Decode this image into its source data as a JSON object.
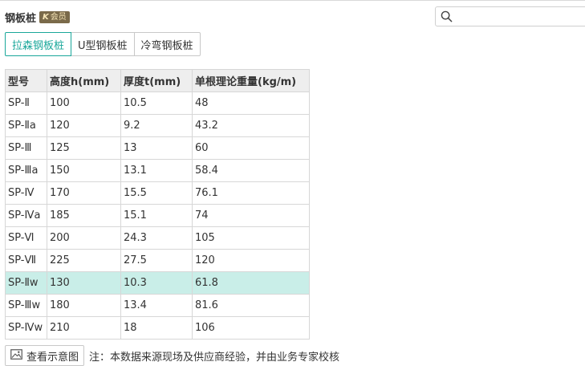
{
  "header": {
    "title": "钢板桩",
    "badge": "会员",
    "badge_mark": "K"
  },
  "search": {
    "value": "",
    "placeholder": ""
  },
  "tabs": [
    {
      "label": "拉森钢板桩",
      "active": true
    },
    {
      "label": "U型钢板桩",
      "active": false
    },
    {
      "label": "冷弯钢板桩",
      "active": false
    }
  ],
  "table": {
    "columns": [
      "型号",
      "高度h(mm)",
      "厚度t(mm)",
      "单根理论重量(kg/m)"
    ],
    "rows": [
      {
        "cells": [
          "SP-Ⅱ",
          "100",
          "10.5",
          "48"
        ],
        "highlight": false
      },
      {
        "cells": [
          "SP-Ⅱa",
          "120",
          "9.2",
          "43.2"
        ],
        "highlight": false
      },
      {
        "cells": [
          "SP-Ⅲ",
          "125",
          "13",
          "60"
        ],
        "highlight": false
      },
      {
        "cells": [
          "SP-Ⅲa",
          "150",
          "13.1",
          "58.4"
        ],
        "highlight": false
      },
      {
        "cells": [
          "SP-Ⅳ",
          "170",
          "15.5",
          "76.1"
        ],
        "highlight": false
      },
      {
        "cells": [
          "SP-Ⅳa",
          "185",
          "15.1",
          "74"
        ],
        "highlight": false
      },
      {
        "cells": [
          "SP-Ⅵ",
          "200",
          "24.3",
          "105"
        ],
        "highlight": false
      },
      {
        "cells": [
          "SP-Ⅶ",
          "225",
          "27.5",
          "120"
        ],
        "highlight": false
      },
      {
        "cells": [
          "SP-Ⅱw",
          "130",
          "10.3",
          "61.8"
        ],
        "highlight": true
      },
      {
        "cells": [
          "SP-Ⅲw",
          "180",
          "13.4",
          "81.6"
        ],
        "highlight": false
      },
      {
        "cells": [
          "SP-Ⅳw",
          "210",
          "18",
          "106"
        ],
        "highlight": false
      }
    ]
  },
  "footer": {
    "view_button_label": "查看示意图",
    "note": "注：本数据来源现场及供应商经验，并由业务专家校核"
  },
  "colors": {
    "accent": "#1aa79a",
    "highlight_row": "#c9eee8",
    "badge_bg": "#7a6a4a"
  },
  "icons": {
    "search": "search-icon",
    "view": "image-icon"
  }
}
